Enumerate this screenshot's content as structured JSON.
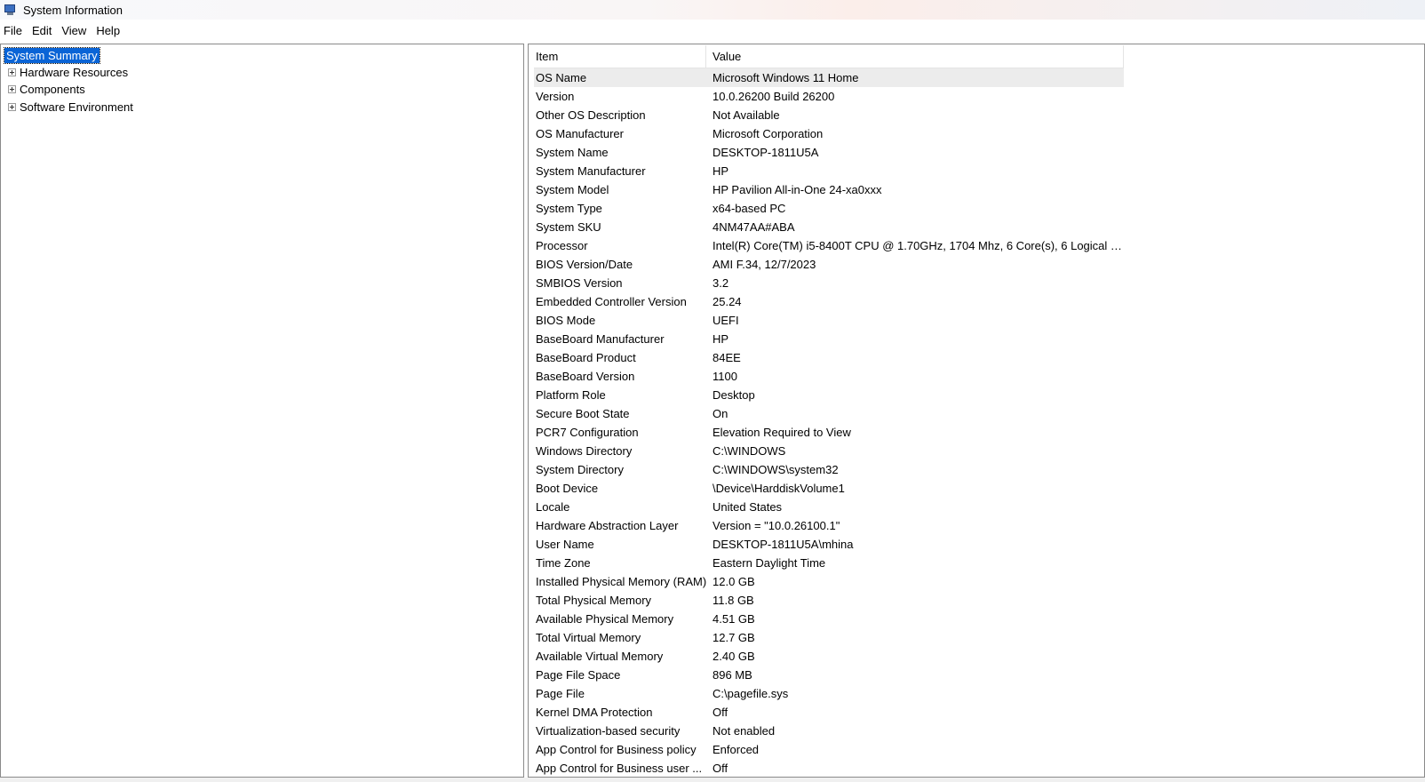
{
  "window": {
    "title": "System Information"
  },
  "menu": [
    "File",
    "Edit",
    "View",
    "Help"
  ],
  "tree": {
    "root": "System Summary",
    "children": [
      "Hardware Resources",
      "Components",
      "Software Environment"
    ]
  },
  "table": {
    "headers": {
      "item": "Item",
      "value": "Value"
    },
    "rows": [
      [
        "OS Name",
        "Microsoft Windows 11 Home"
      ],
      [
        "Version",
        "10.0.26200 Build 26200"
      ],
      [
        "Other OS Description",
        "Not Available"
      ],
      [
        "OS Manufacturer",
        "Microsoft Corporation"
      ],
      [
        "System Name",
        "DESKTOP-1811U5A"
      ],
      [
        "System Manufacturer",
        "HP"
      ],
      [
        "System Model",
        "HP Pavilion All-in-One 24-xa0xxx"
      ],
      [
        "System Type",
        "x64-based PC"
      ],
      [
        "System SKU",
        "4NM47AA#ABA"
      ],
      [
        "Processor",
        "Intel(R) Core(TM) i5-8400T CPU @ 1.70GHz, 1704 Mhz, 6 Core(s), 6 Logical Pr..."
      ],
      [
        "BIOS Version/Date",
        "AMI F.34, 12/7/2023"
      ],
      [
        "SMBIOS Version",
        "3.2"
      ],
      [
        "Embedded Controller Version",
        "25.24"
      ],
      [
        "BIOS Mode",
        "UEFI"
      ],
      [
        "BaseBoard Manufacturer",
        "HP"
      ],
      [
        "BaseBoard Product",
        "84EE"
      ],
      [
        "BaseBoard Version",
        "1100"
      ],
      [
        "Platform Role",
        "Desktop"
      ],
      [
        "Secure Boot State",
        "On"
      ],
      [
        "PCR7 Configuration",
        "Elevation Required to View"
      ],
      [
        "Windows Directory",
        "C:\\WINDOWS"
      ],
      [
        "System Directory",
        "C:\\WINDOWS\\system32"
      ],
      [
        "Boot Device",
        "\\Device\\HarddiskVolume1"
      ],
      [
        "Locale",
        "United States"
      ],
      [
        "Hardware Abstraction Layer",
        "Version = \"10.0.26100.1\""
      ],
      [
        "User Name",
        "DESKTOP-1811U5A\\mhina"
      ],
      [
        "Time Zone",
        "Eastern Daylight Time"
      ],
      [
        "Installed Physical Memory (RAM)",
        "12.0 GB"
      ],
      [
        "Total Physical Memory",
        "11.8 GB"
      ],
      [
        "Available Physical Memory",
        "4.51 GB"
      ],
      [
        "Total Virtual Memory",
        "12.7 GB"
      ],
      [
        "Available Virtual Memory",
        "2.40 GB"
      ],
      [
        "Page File Space",
        "896 MB"
      ],
      [
        "Page File",
        "C:\\pagefile.sys"
      ],
      [
        "Kernel DMA Protection",
        "Off"
      ],
      [
        "Virtualization-based security",
        "Not enabled"
      ],
      [
        "App Control for Business policy",
        "Enforced"
      ],
      [
        "App Control for Business user ...",
        "Off"
      ]
    ]
  },
  "icons": {
    "app": "system-information-icon",
    "expander": "plus-box-icon"
  },
  "colors": {
    "selection": "#0a64d6",
    "selected_row": "#ececec"
  }
}
